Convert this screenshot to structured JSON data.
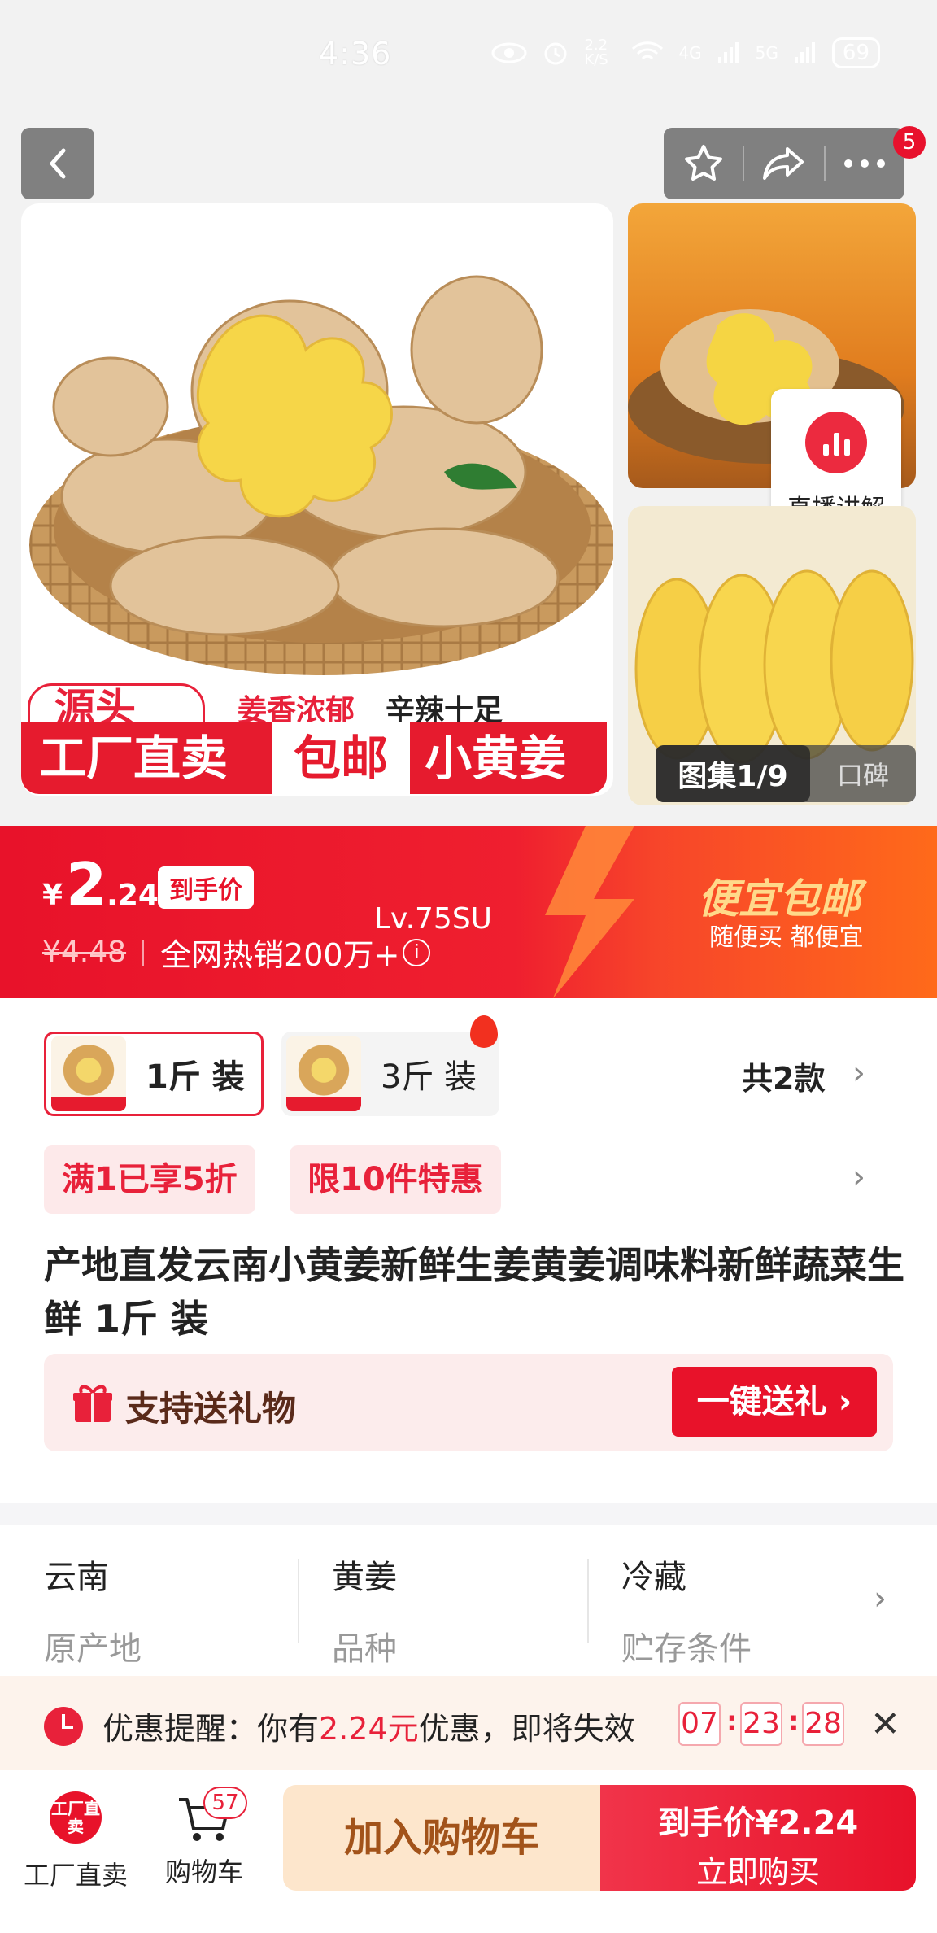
{
  "status_bar": {
    "time": "4:36",
    "net_speed": "2.2 K/S",
    "signal_1": "4G",
    "signal_2": "5G",
    "battery": "69",
    "icons": [
      "eye-icon",
      "alarm-icon",
      "wifi-icon",
      "signal-icon",
      "battery-icon"
    ]
  },
  "header": {
    "icons": [
      "back-icon",
      "star-icon",
      "share-icon",
      "more-icon"
    ],
    "more_badge": "5"
  },
  "gallery": {
    "live_label": "直播讲解",
    "counter_label": "图集1/9",
    "reviews_label": "口碑",
    "banner": {
      "origin": "源头",
      "tag_aroma": "姜香浓郁",
      "tag_spicy": "辛辣十足",
      "factory": "工厂直卖",
      "free_ship": "包邮",
      "product": "小黄姜"
    }
  },
  "price": {
    "currency": "¥",
    "integer": "2",
    "decimal": ".24",
    "final_label": "到手价",
    "original": "¥4.48",
    "sales": "全网热销200万+",
    "overlay": "Lv.75SU",
    "promo_title": "便宜包邮",
    "promo_sub": "随便买 都便宜"
  },
  "variants": {
    "items": [
      {
        "label": "1斤 装",
        "selected": true
      },
      {
        "label": "3斤 装",
        "selected": false
      }
    ],
    "count_label": "共2款"
  },
  "promos": [
    "满1已享5折",
    "限10件特惠"
  ],
  "title": "产地直发云南小黄姜新鲜生姜黄姜调味料新鲜蔬菜生鲜 1斤 装",
  "gift": {
    "label": "支持送礼物",
    "button": "一键送礼"
  },
  "attributes": [
    {
      "value": "云南",
      "key": "原产地"
    },
    {
      "value": "黄姜",
      "key": "品种"
    },
    {
      "value": "冷藏",
      "key": "贮存条件"
    }
  ],
  "reminder": {
    "prefix": "优惠提醒：你有",
    "amount": "2.24元",
    "suffix": "优惠，即将失效",
    "countdown": {
      "h": "07",
      "m": "23",
      "s": "28"
    }
  },
  "bottom_bar": {
    "factory_logo": "工厂直卖",
    "factory_label": "工厂直卖",
    "cart_label": "购物车",
    "cart_count": "57",
    "add_to_cart": "加入购物车",
    "buy_line1": "到手价¥2.24",
    "buy_line2": "立即购买"
  },
  "colors": {
    "accent": "#e8122a",
    "promo_orange": "#ff6a1a",
    "cart_button_bg": "#fde6cc"
  }
}
